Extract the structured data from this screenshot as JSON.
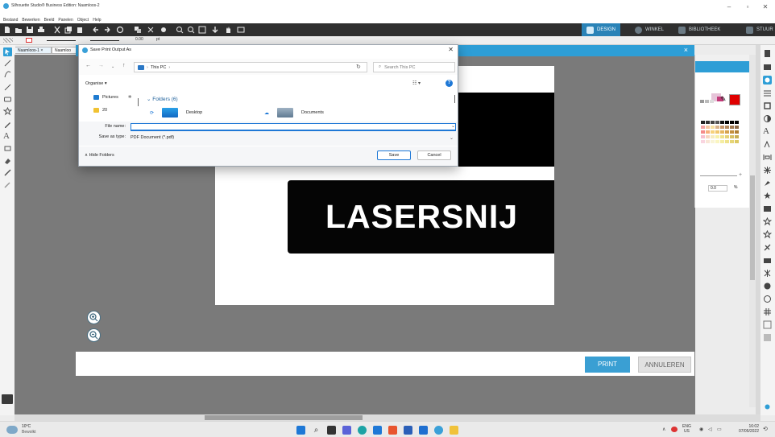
{
  "app": {
    "title": "Silhouette Studio® Business Edition: Naamloos-2",
    "menu": [
      "Bestand",
      "Bewerken",
      "Beeld",
      "Panelen",
      "Object",
      "Help"
    ],
    "mode_tabs": {
      "design": "DESIGN",
      "winkel": "WINKEL",
      "bibliotheek": "BIBLIOTHEEK",
      "stuur": "STUUR"
    },
    "toolbar2": {
      "line_width": "0.00",
      "unit": "pt"
    },
    "doc_tabs": [
      "Naamloos-1",
      "Naamloo"
    ],
    "accent_color": "#2e9ed6"
  },
  "canvas": {
    "text": "LASERSNIJ"
  },
  "print_panel": {
    "print_label": "PRINT",
    "cancel_label": "ANNULEREN"
  },
  "color_panel": {
    "value": "0.0",
    "unit": "%"
  },
  "dialog": {
    "title": "Save Print Output As",
    "address": "This PC",
    "search_placeholder": "Search This PC",
    "organise_label": "Organise",
    "sidebar": [
      {
        "label": "Pictures",
        "icon": "pictures-icon"
      },
      {
        "label": "20",
        "icon": "folder-icon"
      }
    ],
    "folders_header": "Folders (6)",
    "folders": [
      {
        "label": "Desktop",
        "icon": "desktop-folder-icon"
      },
      {
        "label": "Documents",
        "icon": "documents-folder-icon"
      }
    ],
    "file_name_label": "File name:",
    "file_name_value": "",
    "save_type_label": "Save as type:",
    "save_type_value": "PDF Document (*.pdf)",
    "hide_folders_label": "Hide Folders",
    "save_label": "Save",
    "cancel_label": "Cancel"
  },
  "taskbar": {
    "temperature": "10°C",
    "weather": "Bewolkt",
    "lang_top": "ENG",
    "lang_bottom": "US",
    "time": "16:02",
    "date": "07/05/2022"
  }
}
